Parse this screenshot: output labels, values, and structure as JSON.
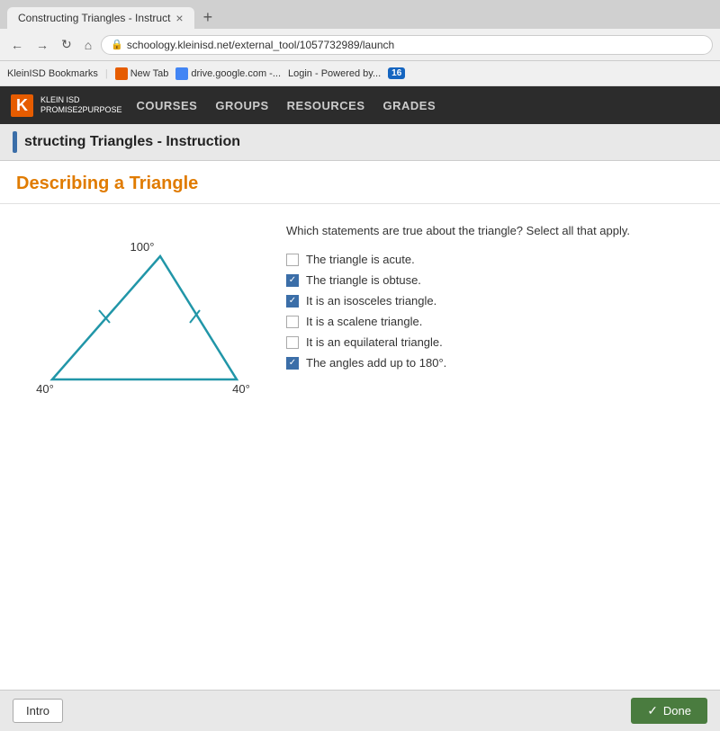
{
  "browser": {
    "tab_title": "Constructing Triangles - Instruct",
    "tab_close": "×",
    "new_tab": "+",
    "url": "schoology.kleinisd.net/external_tool/1057732989/launch",
    "back_btn": "←",
    "forward_btn": "→",
    "reload_btn": "↻",
    "home_btn": "⌂",
    "lock_icon": "🔒",
    "bookmarks_label": "KleinISD Bookmarks",
    "bm_new_tab": "New Tab",
    "bm_google": "drive.google.com -...",
    "bm_login": "Login - Powered by...",
    "badge_num": "16"
  },
  "nav": {
    "logo_k": "K",
    "logo_line1": "KLEIN ISD",
    "logo_line2": "PROMISE2PURPOSE",
    "courses": "COURSES",
    "groups": "GROUPS",
    "resources": "RESOURCES",
    "grades": "GRADES"
  },
  "page": {
    "header_title": "structing Triangles - Instruction",
    "section_title": "Describing a Triangle"
  },
  "quiz": {
    "question": "Which statements are true about the triangle? Select all that apply.",
    "options": [
      {
        "text": "The triangle is acute.",
        "checked": false
      },
      {
        "text": "The triangle is obtuse.",
        "checked": true
      },
      {
        "text": "It is an isosceles triangle.",
        "checked": true
      },
      {
        "text": "It is a scalene triangle.",
        "checked": false
      },
      {
        "text": "It is an equilateral triangle.",
        "checked": false
      },
      {
        "text": "The angles add up to 180°.",
        "checked": true
      }
    ]
  },
  "triangle": {
    "angle_top": "100°",
    "angle_left": "40°",
    "angle_right": "40°"
  },
  "footer": {
    "intro_label": "Intro",
    "done_label": "Done"
  }
}
